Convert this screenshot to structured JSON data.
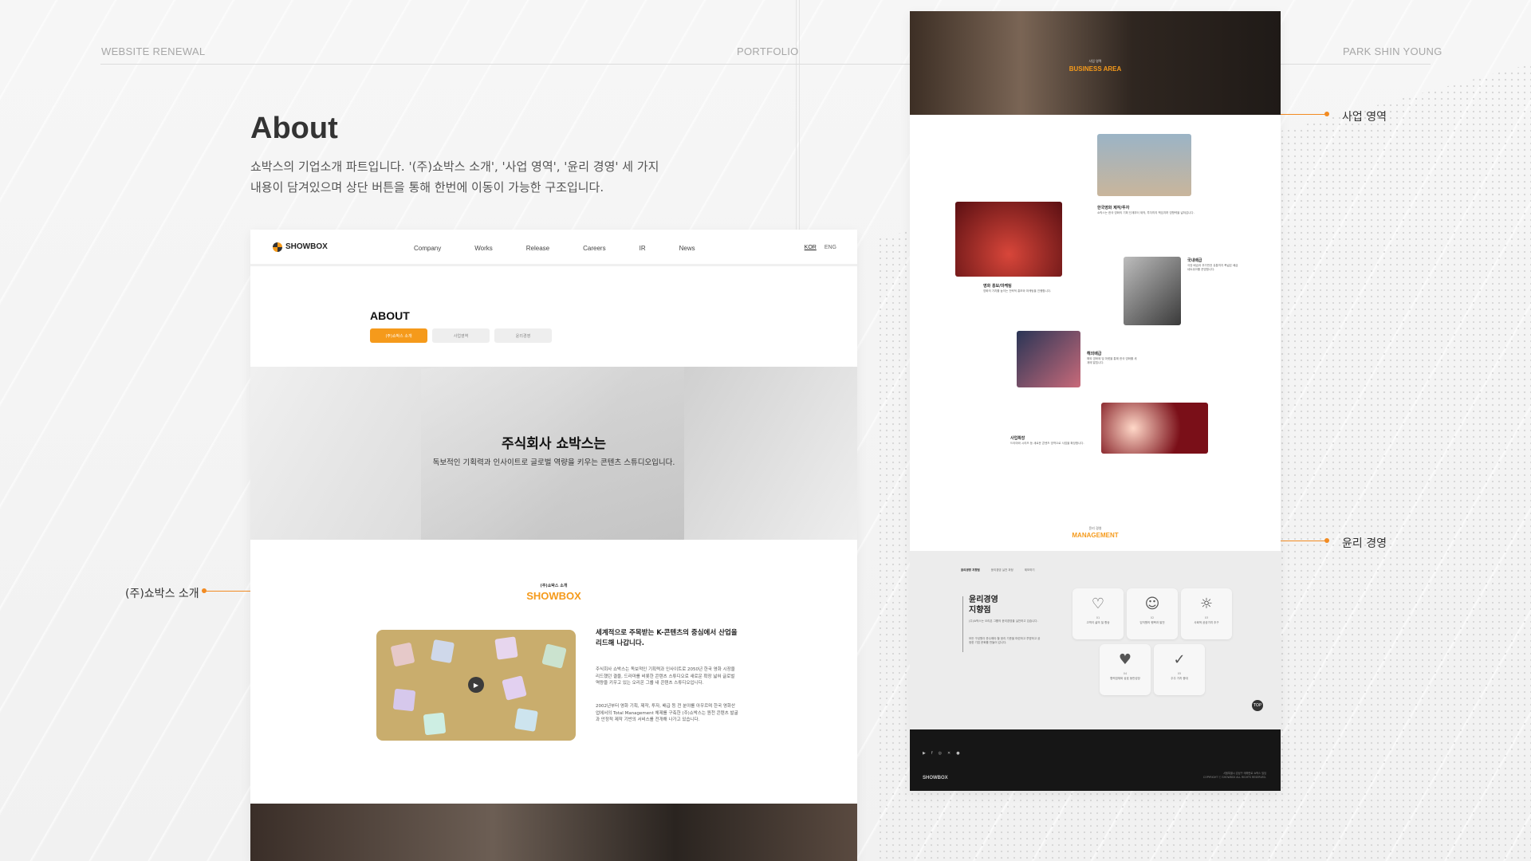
{
  "header": {
    "left": "WEBSITE RENEWAL",
    "center": "PORTFOLIO",
    "right": "PARK SHIN YOUNG"
  },
  "intro": {
    "title": "About",
    "description_line1": "쇼박스의 기업소개 파트입니다. '(주)쇼박스 소개', '사업 영역', '윤리 경영' 세 가지",
    "description_line2": "내용이 담겨있으며 상단 버튼을 통해 한번에 이동이 가능한 구조입니다."
  },
  "callouts": {
    "business": "사업 영역",
    "ethics": "윤리 경영",
    "showbox": "(주)쇼박스 소개"
  },
  "accent_color": "#f59a1b",
  "left_mockup": {
    "logo": "SHOWBOX",
    "menu": [
      "Company",
      "Works",
      "Release",
      "Careers",
      "IR",
      "News"
    ],
    "lang": [
      "KOR",
      "ENG"
    ],
    "section_title": "ABOUT",
    "tabs": [
      "(주)쇼박스 소개",
      "사업영역",
      "윤리경영"
    ],
    "hero_title": "주식회사 쇼박스는",
    "hero_sub": "독보적인 기획력과 인사이트로 글로벌 역량을 키우는 콘텐츠 스튜디오입니다.",
    "intro_sub": "(주)쇼박스 소개",
    "intro_title": "SHOWBOX",
    "text_heading": "세계적으로 주목받는 K-콘텐츠의 중심에서 산업을 리드해 나갑니다.",
    "para1": "주식회사 쇼박스는 독보적인 기획력과 인사이트로 2050년 한국 영화 시장을 리드했던 결을, 드라마를 비롯한 콘텐츠 스튜디오로 새로운 확장 넓혀 글로벌 역량을 키우고 있는 오리온 그룹 내 콘텐츠 스튜디오입니다.",
    "para2": "2002년부터 영화 기획, 제작, 투자, 배급 등 전 분야를 아우르며 한국 영화산업에서의 Total Management 체제를 구축한 (주)쇼박스는 원천 콘텐츠 발굴과 안정적 제작 기반의 서비스를 전개해 나가고 있습니다."
  },
  "right_mockup": {
    "banner_sub": "사업 영역",
    "banner_title": "BUSINESS AREA",
    "items": [
      {
        "title": "한국영화 제작/투자",
        "desc": "쇼박스는 한국 영화의 기획 단계부터 제작, 투자까지 책임지며 영향력을 넓혀갑니다."
      },
      {
        "title": "영화 홍보/마케팅",
        "desc": "영화의 가치를 높이는 전략적 홍보와 마케팅을 진행합니다."
      },
      {
        "title": "국내배급",
        "desc": "극장 배급과 부가판권 유통까지 폭넓은 배급 네트워크를 운영합니다."
      },
      {
        "title": "해외배급",
        "desc": "해외 영화제 및 마켓을 통해 한국 영화를 세계에 알립니다."
      },
      {
        "title": "사업확장",
        "desc": "드라마와 시리즈 등 새로운 콘텐츠 영역으로 사업을 확장합니다."
      }
    ],
    "mgmt_sub": "윤리 경영",
    "mgmt_title": "MANAGEMENT",
    "ethics_tabs": [
      "윤리경영 지향점",
      "윤리경영 실천 과정",
      "제보하기"
    ],
    "ethics_title_1": "윤리경영",
    "ethics_title_2": "지향점",
    "ethics_p1": "(주)쇼박스는 오리온 그룹의 윤리경영을 실천하고 있습니다.",
    "ethics_p2": "모든 구성원이 준수해야 할 윤리 기준을 마련하고 투명하고 공정한 기업 문화를 만들어 갑니다.",
    "cards": [
      {
        "num": "01",
        "label": "고객이 삶의 질 향상",
        "icon": "hand-heart-icon"
      },
      {
        "num": "02",
        "label": "임직원의 행복과 발전",
        "icon": "people-icon"
      },
      {
        "num": "03",
        "label": "사회적 공공가치 추구",
        "icon": "lightbulb-icon"
      },
      {
        "num": "04",
        "label": "협력업체와 상호 동반성장",
        "icon": "handshake-icon"
      },
      {
        "num": "05",
        "label": "주주 가치 증대",
        "icon": "thumbs-up-icon"
      }
    ],
    "top_label": "TOP",
    "footer_logo": "SHOWBOX",
    "footer_copy1": "서울특별시 강남구 테헤란로 쇼박스 빌딩",
    "footer_copy2": "COPYRIGHT ⓒ SHOWBOX ALL RIGHTS RESERVED."
  }
}
